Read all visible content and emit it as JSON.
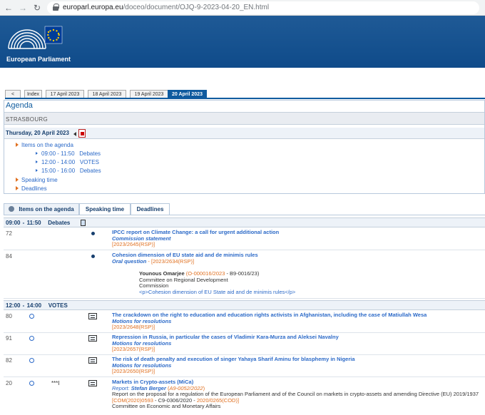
{
  "browser": {
    "back_icon": "arrow-left-icon",
    "forward_icon": "arrow-right-icon",
    "reload_icon": "reload-icon",
    "url_domain": "europarl.europa.eu",
    "url_path": "/doceo/document/OJQ-9-2023-04-20_EN.html"
  },
  "header": {
    "site_name": "European Parliament"
  },
  "day_tabs": {
    "back": "<",
    "items": [
      "Index",
      "17 April 2023",
      "18 April 2023",
      "19 April 2023",
      "20 April 2023"
    ],
    "active": "20 April 2023"
  },
  "agenda": {
    "title": "Agenda",
    "location": "STRASBOURG",
    "date": "Thursday, 20 April 2023",
    "toc": {
      "items_label": "Items on the agenda",
      "sessions": [
        "09:00 - 11:50   Debates",
        "12:00 - 14:00   VOTES",
        "15:00 - 16:00   Debates"
      ],
      "speaking_time": "Speaking time",
      "deadlines": "Deadlines"
    }
  },
  "bottom_tabs": {
    "items": [
      "Items on the agenda",
      "Speaking time",
      "Deadlines"
    ],
    "active": "Items on the agenda"
  },
  "sessions": [
    {
      "label": "09:00 - 11:50   Debates",
      "items": [
        {
          "number": "72",
          "title": "IPCC report on Climate Change: a call for urgent additional action",
          "subtitle": "Commission statement",
          "ref_open": "[",
          "ref": "2023/2645(RSP)",
          "ref_close": "]"
        },
        {
          "number": "84",
          "title": "Cohesion dimension of EU state aid and de minimis rules",
          "subtitle": "Oral question",
          "subtitle_sep": " - [",
          "ref": "2023/2634(RSP)",
          "ref_close": "]",
          "author": "Younous Omarjee",
          "author_ref_open": " (",
          "author_ref": "O-000016/2023",
          "author_ref_rest": " - B9-0016/23)",
          "committee": "Committee on Regional Development",
          "addressee": "Commission",
          "html_note": "<p>Cohesion dimension of EU State aid and de minimis rules</p>"
        }
      ]
    },
    {
      "label": "12:00 - 14:00   VOTES",
      "items": [
        {
          "number": "80",
          "title": "The crackdown on the right to education and education rights activists in Afghanistan, including the case of Matiullah Wesa",
          "subtitle": "Motions for resolutions",
          "ref_open": "[",
          "ref": "2023/2648(RSP)",
          "ref_close": "]"
        },
        {
          "number": "91",
          "title": "Repression in Russia, in particular the cases of Vladimir Kara-Murza and Aleksei Navalny",
          "subtitle": "Motions for resolutions",
          "ref_open": "[",
          "ref": "2023/2657(RSP)",
          "ref_close": "]"
        },
        {
          "number": "82",
          "title": "The risk of death penalty and execution of singer Yahaya Sharif Aminu for blasphemy in Nigeria",
          "subtitle": "Motions for resolutions",
          "ref_open": "[",
          "ref": "2023/2650(RSP)",
          "ref_close": "]"
        },
        {
          "number": "20",
          "stars": "***I",
          "title": "Markets in Crypto-assets (MiCa)",
          "report_label": "Report:",
          "rapporteur": "Stefan Berger",
          "report_ref_open": " (",
          "report_ref": "A9-0052/2022",
          "report_ref_close": ")",
          "description": "Report on the proposal for a regulation of the European Parliament and of the Council on markets in crypto-assets and amending Directive (EU) 2019/1937",
          "com_open": "[",
          "com_ref": "COM(2020)0593",
          "com_mid": " - C9-0306/2020 - ",
          "proc_ref": "2020/0265(COD)",
          "com_close": "]",
          "committee": "Committee on Economic and Monetary Affairs"
        }
      ]
    }
  ],
  "colors": {
    "brand_blue": "#0f5b9f",
    "link_blue": "#2c6ac8",
    "reference_orange": "#e07020"
  }
}
